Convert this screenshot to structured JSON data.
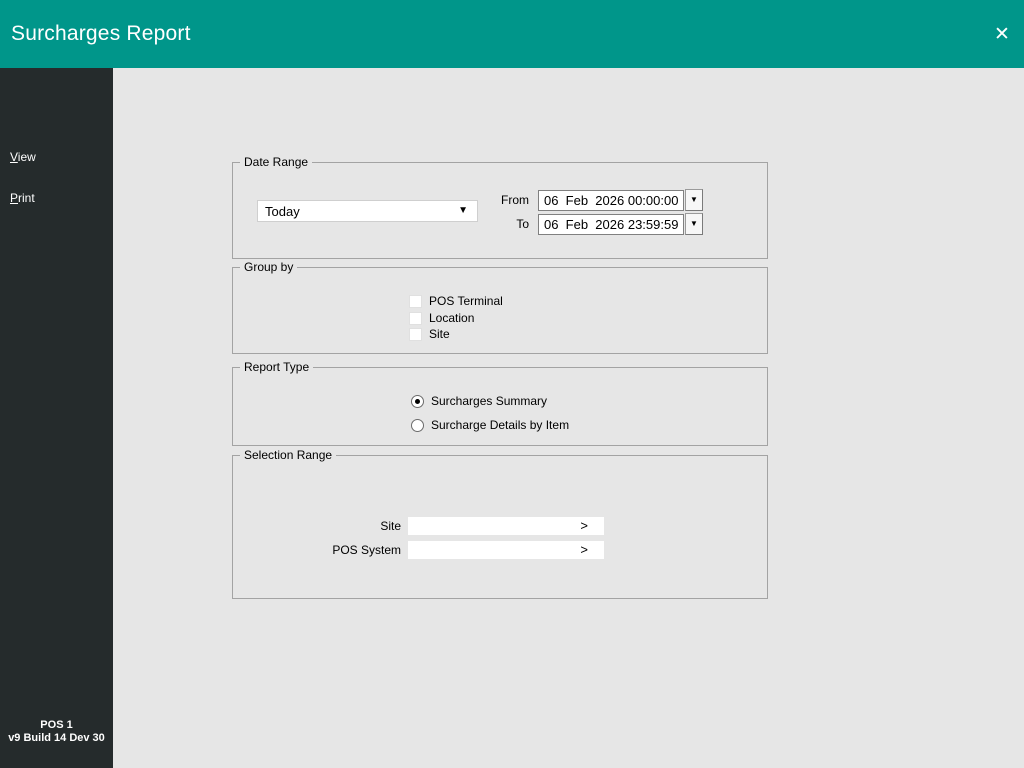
{
  "window": {
    "title": "Surcharges Report",
    "close_glyph": "✕"
  },
  "sidebar": {
    "items": [
      {
        "first": "V",
        "rest": "iew"
      },
      {
        "first": "P",
        "rest": "rint"
      }
    ],
    "footer_line1": "POS 1",
    "footer_line2": "v9 Build 14 Dev 30"
  },
  "date_range": {
    "legend": "Date Range",
    "preset_value": "Today",
    "combo_arrow": "▼",
    "spin_arrow": "▼",
    "from_label": "From",
    "from_value": "06  Feb  2026 00:00:00",
    "to_label": "To",
    "to_value": "06  Feb  2026 23:59:59"
  },
  "group_by": {
    "legend": "Group by",
    "options": [
      {
        "label": "POS Terminal",
        "checked": false
      },
      {
        "label": "Location",
        "checked": false
      },
      {
        "label": "Site",
        "checked": false
      }
    ]
  },
  "report_type": {
    "legend": "Report Type",
    "options": [
      {
        "label": "Surcharges Summary",
        "selected": true
      },
      {
        "label": "Surcharge Details by Item",
        "selected": false
      }
    ]
  },
  "selection_range": {
    "legend": "Selection Range",
    "fields": [
      {
        "label": "Site",
        "value": "",
        "picker_glyph": ">"
      },
      {
        "label": "POS System",
        "value": "",
        "picker_glyph": ">"
      }
    ]
  },
  "colors": {
    "header": "#00968A",
    "sidebar": "#252B2C",
    "background": "#E6E6E6"
  }
}
